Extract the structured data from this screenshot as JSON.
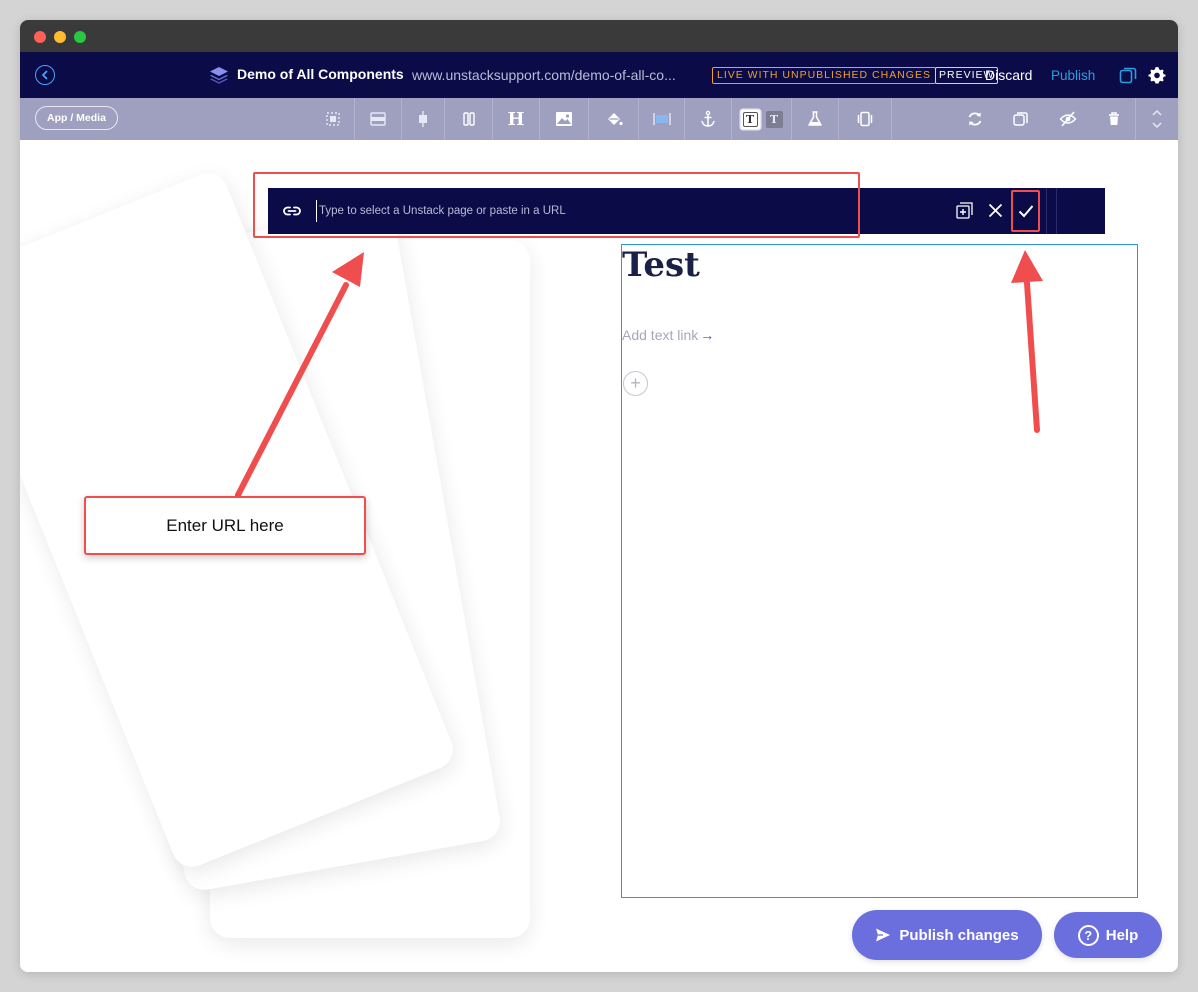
{
  "window": {
    "traffic_lights": [
      "close",
      "minimize",
      "maximize"
    ]
  },
  "topnav": {
    "site_title": "Demo of All Components",
    "site_url": "www.unstacksupport.com/demo-of-all-co...",
    "live_badge": "LIVE WITH UNPUBLISHED CHANGES",
    "preview_badge": "PREVIEW",
    "discard_label": "Discard",
    "publish_label": "Publish",
    "icons": [
      "back-icon",
      "layers-icon",
      "copy-icon",
      "settings-icon"
    ]
  },
  "toolbar": {
    "app_media_label": "App / Media",
    "heading_glyph": "H",
    "text_style_glyph_light": "T",
    "text_style_glyph_dark": "T",
    "tools": [
      "crop",
      "section-width",
      "align-vertical",
      "columns",
      "heading",
      "image",
      "fill",
      "full-width",
      "anchor",
      "text-style-light",
      "text-style-dark",
      "ab-test",
      "carousel",
      "rotate",
      "duplicate",
      "hide",
      "delete",
      "move-up-down"
    ]
  },
  "url_bar": {
    "placeholder": "Type to select a Unstack page or paste in a URL",
    "value": "",
    "icons": [
      "link-icon",
      "add-page-icon",
      "close-icon",
      "check-icon"
    ]
  },
  "content": {
    "heading": "Test",
    "text_link_label": "Add text link",
    "text_link_arrow": "→",
    "add_button_glyph": "+"
  },
  "floating": {
    "publish_changes_label": "Publish changes",
    "help_label": "Help",
    "help_glyph": "?"
  },
  "annotations": {
    "callout_text": "Enter URL here",
    "highlight_color": "#f04e4e"
  },
  "colors": {
    "nav_bg": "#0b0b48",
    "toolbar_bg": "#9f9fbf",
    "accent_blue": "#2d9de0",
    "badge_orange": "#f0a030",
    "button_purple": "#6b6fde",
    "selection_border": "#2b9ad8"
  }
}
